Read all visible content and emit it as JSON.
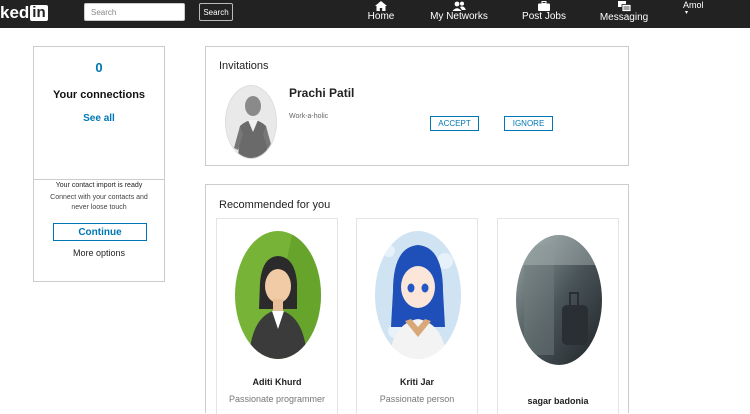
{
  "topbar": {
    "logo_text": "ked",
    "logo_in": "in",
    "search_placeholder": "Search",
    "search_button": "Search",
    "nav": [
      {
        "label": "Home",
        "icon": "home-icon"
      },
      {
        "label": "My Networks",
        "icon": "people-icon"
      },
      {
        "label": "Post Jobs",
        "icon": "briefcase-icon"
      },
      {
        "label": "Messaging",
        "icon": "messages-icon"
      }
    ],
    "user_name": "Amol",
    "user_caret": "▾"
  },
  "connections": {
    "count": "0",
    "label": "Your connections",
    "see_all": "See all",
    "import_title": "Your contact import is ready",
    "import_text": "Connect with your contacts and never loose touch",
    "continue_label": "Continue",
    "more_options": "More options"
  },
  "invitations": {
    "title": "Invitations",
    "items": [
      {
        "name": "Prachi Patil",
        "headline": "Work-a-holic",
        "accept_label": "ACCEPT",
        "ignore_label": "IGNORE"
      }
    ]
  },
  "recommended": {
    "title": "Recommended for you",
    "people": [
      {
        "name": "Aditi Khurd",
        "headline": "Passionate programmer"
      },
      {
        "name": "Kriti Jar",
        "headline": "Passionate person"
      },
      {
        "name": "sagar badonia",
        "headline": ""
      }
    ]
  },
  "colors": {
    "topbar": "#222222",
    "accent": "#0077b5",
    "border": "#cccccc"
  }
}
